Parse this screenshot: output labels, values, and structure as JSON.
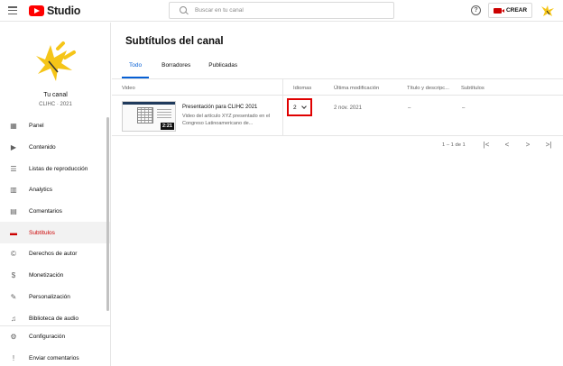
{
  "topbar": {
    "logo_text": "Studio",
    "search_placeholder": "Buscar en tu canal",
    "help_symbol": "?",
    "create_label": "CREAR"
  },
  "channel": {
    "name": "Tu canal",
    "subtitle": "CLIHC · 2021"
  },
  "nav": {
    "items": [
      {
        "label": "Panel",
        "icon": "dashboard-icon",
        "glyph": "▦"
      },
      {
        "label": "Contenido",
        "icon": "content-icon",
        "glyph": "▶"
      },
      {
        "label": "Listas de reproducción",
        "icon": "playlists-icon",
        "glyph": "☰"
      },
      {
        "label": "Analytics",
        "icon": "analytics-icon",
        "glyph": "▥"
      },
      {
        "label": "Comentarios",
        "icon": "comments-icon",
        "glyph": "▤"
      },
      {
        "label": "Subtítulos",
        "icon": "subtitles-icon",
        "glyph": "▬"
      },
      {
        "label": "Derechos de autor",
        "icon": "copyright-icon",
        "glyph": "©"
      },
      {
        "label": "Monetización",
        "icon": "dollar-icon",
        "glyph": "$"
      },
      {
        "label": "Personalización",
        "icon": "magic-wand-icon",
        "glyph": "✎"
      },
      {
        "label": "Biblioteca de audio",
        "icon": "audio-library-icon",
        "glyph": "♫"
      }
    ],
    "bottom": [
      {
        "label": "Configuración",
        "icon": "gear-icon",
        "glyph": "⚙"
      },
      {
        "label": "Enviar comentarios",
        "icon": "feedback-icon",
        "glyph": "!"
      }
    ],
    "active_index": 5
  },
  "main": {
    "title": "Subtítulos del canal",
    "tabs": [
      "Todo",
      "Borradores",
      "Publicadas"
    ],
    "active_tab": 0,
    "columns": {
      "video": "Video",
      "languages": "Idiomas",
      "modified": "Última modificación",
      "title_desc": "Título y descripc...",
      "subtitles": "Subtítulos"
    },
    "rows": [
      {
        "duration": "2:21",
        "title": "Presentación para CLIHC 2021",
        "description": "Video del artículo XYZ presentado en el Congreso Latinoamericano de...",
        "languages": "2",
        "modified": "2 nov. 2021",
        "title_desc": "–",
        "subtitles": "–"
      }
    ],
    "pagination": {
      "range": "1 – 1 de 1",
      "first": "|<",
      "prev": "<",
      "next": ">",
      "last": ">|"
    }
  },
  "colors": {
    "accent": "#065fd4",
    "active_red": "#cc0000",
    "highlight_box": "#e00000",
    "logo_yellow": "#f5c518"
  }
}
